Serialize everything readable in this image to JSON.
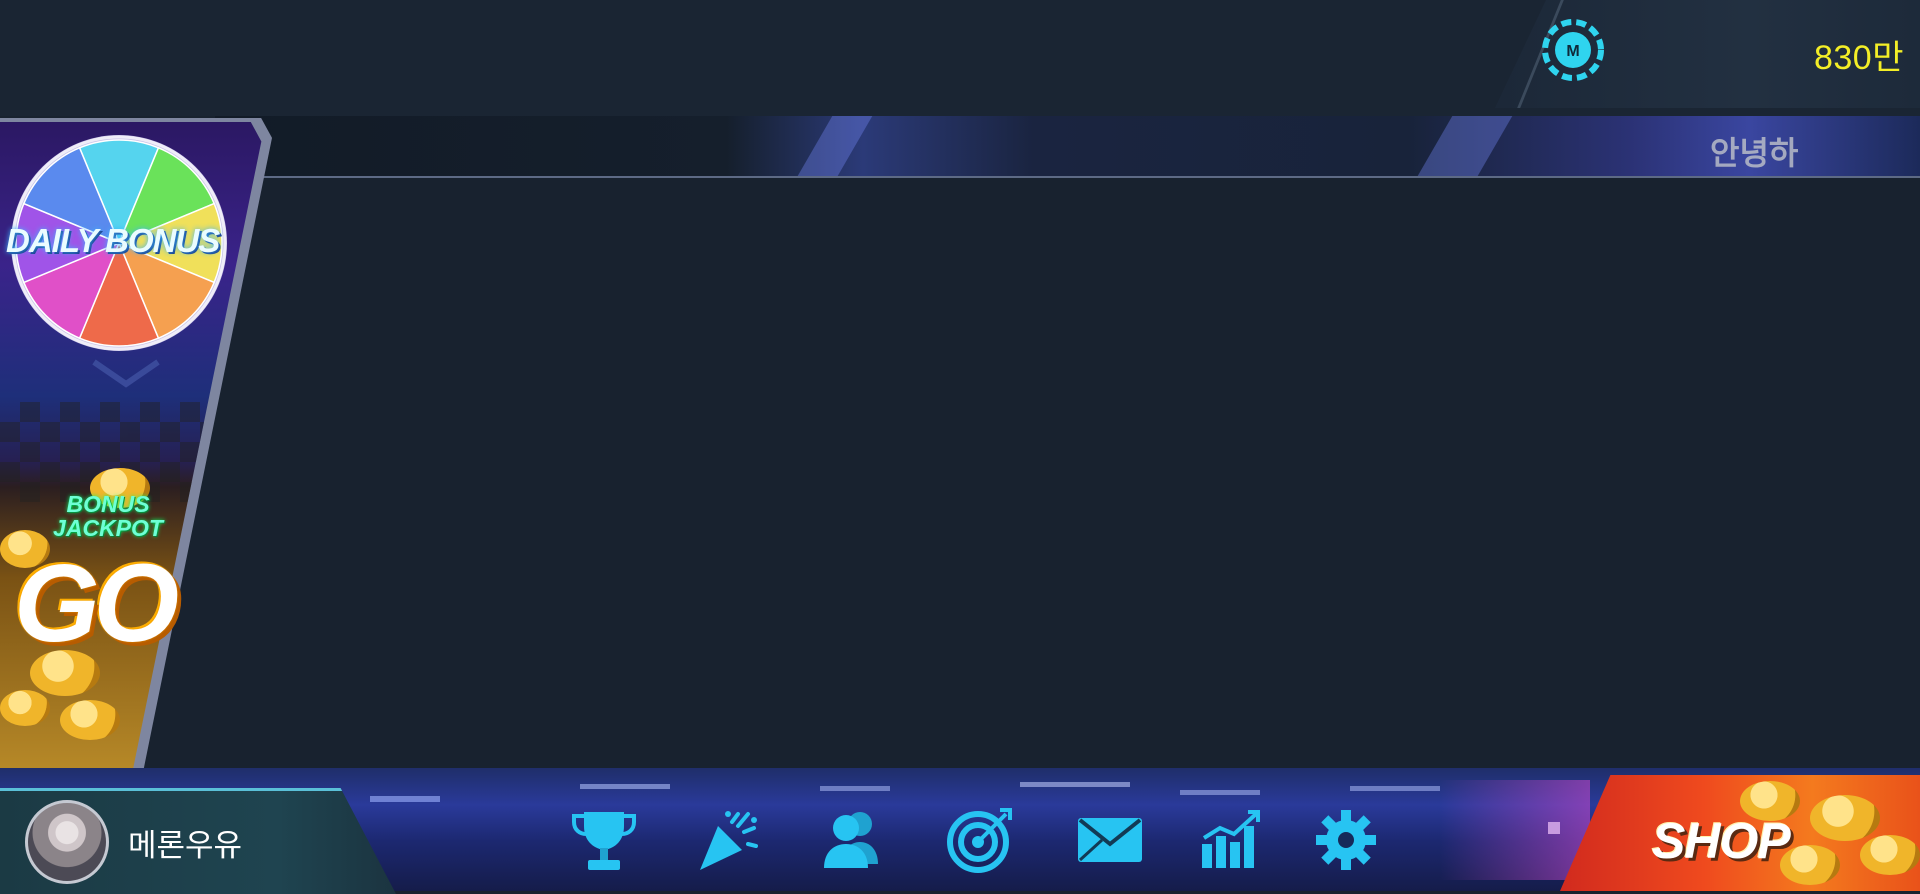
{
  "top_bar": {
    "currency_icon": "chip-icon",
    "currency_label": "M",
    "coin_amount": "830만"
  },
  "marquee": {
    "text": "안녕하"
  },
  "promo_panel": {
    "daily_bonus": {
      "label": "DAILY BONUS",
      "icon": "prize-wheel-icon",
      "wheel_colors": [
        "#55d4ee",
        "#6ae25a",
        "#f0e05a",
        "#f5a050",
        "#ee6a4a",
        "#e050c8",
        "#a054e8",
        "#5a8aee"
      ]
    },
    "chevron_icon": "chevron-down-icon",
    "bonus_jackpot": {
      "line1": "BONUS",
      "line2": "JACKPOT",
      "go_label": "GO"
    }
  },
  "profile": {
    "avatar": "avatar",
    "username": "메론우유"
  },
  "nav": {
    "items": [
      {
        "name": "trophy-icon"
      },
      {
        "name": "party-popper-icon"
      },
      {
        "name": "friends-icon"
      },
      {
        "name": "target-icon"
      },
      {
        "name": "mail-icon"
      },
      {
        "name": "stats-chart-icon"
      },
      {
        "name": "settings-gear-icon"
      }
    ],
    "icon_color": "#27c4f2"
  },
  "shop": {
    "label": "SHOP"
  },
  "colors": {
    "background": "#18222f",
    "coin_text": "#f3ee27",
    "accent_cyan": "#27c4f2",
    "shop_orange": "#ef4a1e"
  }
}
